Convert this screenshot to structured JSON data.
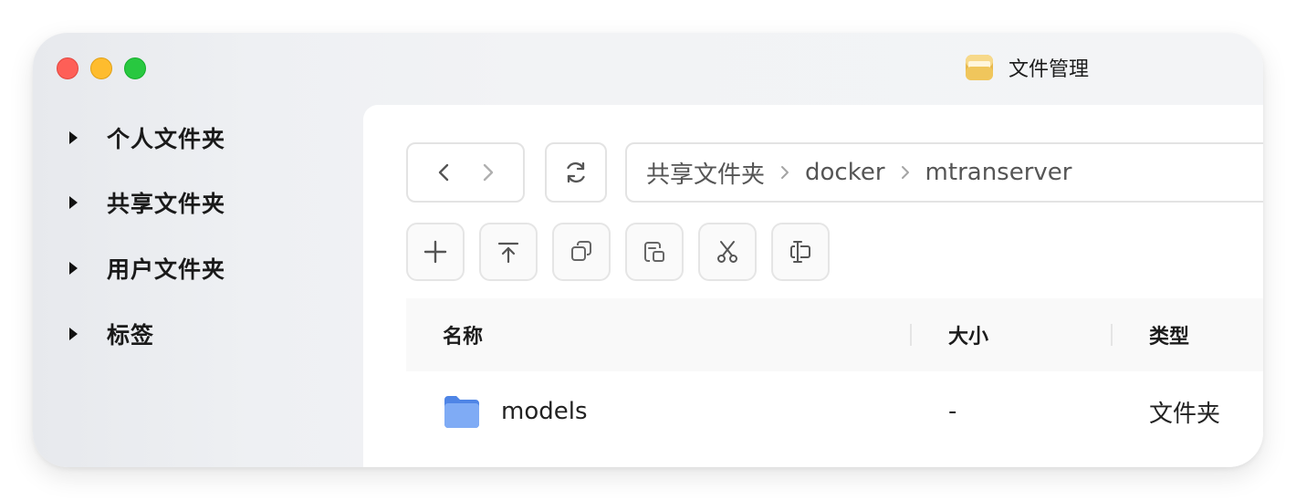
{
  "window": {
    "title": "文件管理",
    "app_icon": "folder-app-icon",
    "traffic_lights": {
      "close": "#fe5f57",
      "minimize": "#febc2e",
      "zoom": "#28c840"
    }
  },
  "sidebar": {
    "items": [
      {
        "label": "个人文件夹",
        "icon": "caret-right-icon"
      },
      {
        "label": "共享文件夹",
        "icon": "caret-right-icon"
      },
      {
        "label": "用户文件夹",
        "icon": "caret-right-icon"
      },
      {
        "label": "标签",
        "icon": "caret-right-icon"
      }
    ]
  },
  "navigation": {
    "back_icon": "chevron-left-icon",
    "forward_icon": "chevron-right-icon",
    "refresh_icon": "refresh-icon"
  },
  "breadcrumb": {
    "items": [
      "共享文件夹",
      "docker",
      "mtranserver"
    ]
  },
  "toolbar": {
    "buttons": [
      {
        "name": "new",
        "icon": "plus-icon"
      },
      {
        "name": "upload",
        "icon": "upload-icon"
      },
      {
        "name": "copy",
        "icon": "copy-icon"
      },
      {
        "name": "paste",
        "icon": "paste-icon"
      },
      {
        "name": "cut",
        "icon": "scissors-icon"
      },
      {
        "name": "rename",
        "icon": "rename-icon"
      }
    ]
  },
  "table": {
    "columns": [
      "名称",
      "大小",
      "类型"
    ],
    "rows": [
      {
        "name": "models",
        "size": "-",
        "type": "文件夹",
        "icon": "folder-icon"
      }
    ]
  },
  "colors": {
    "folder": "#6f9df2",
    "border": "#e3e3e3",
    "header_bg": "#f9f9f9"
  }
}
